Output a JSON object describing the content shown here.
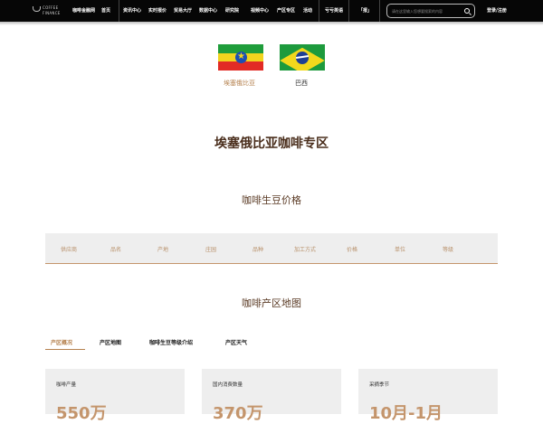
{
  "nav": {
    "logo_line1": "COFFEE",
    "logo_line2": "FINANCE",
    "items": [
      "咖啡金融网",
      "首页",
      "资讯中心",
      "实时报价",
      "贸易大厅",
      "数据中心",
      "研究院",
      "视频中心",
      "产区专区",
      "活动",
      "亏亏英语",
      "「报」"
    ],
    "search_placeholder": "请在这里输入您想要搜索的内容",
    "login": "登录/注册"
  },
  "flags": [
    {
      "name": "ethiopia-flag",
      "label": "埃塞俄比亚",
      "active": true
    },
    {
      "name": "brazil-flag",
      "label": "巴西",
      "active": false
    }
  ],
  "page_title": "埃塞俄比亚咖啡专区",
  "price_section": {
    "title": "咖啡生豆价格",
    "columns": [
      "供应商",
      "品名",
      "产地",
      "庄园",
      "品种",
      "加工方式",
      "价格",
      "单位",
      "等级"
    ]
  },
  "map_section": {
    "title": "咖啡产区地图",
    "tabs": [
      "产区概况",
      "产区地图",
      "咖啡生豆等级介绍",
      "产区天气"
    ]
  },
  "stats": [
    {
      "label": "咖啡产量",
      "value": "550万"
    },
    {
      "label": "国内消费数量",
      "value": "370万"
    },
    {
      "label": "采摘季节",
      "value": "10月-1月"
    }
  ],
  "colors": {
    "accent": "#b5814e",
    "nav_bg": "#060606",
    "title": "#4a2e1c"
  }
}
